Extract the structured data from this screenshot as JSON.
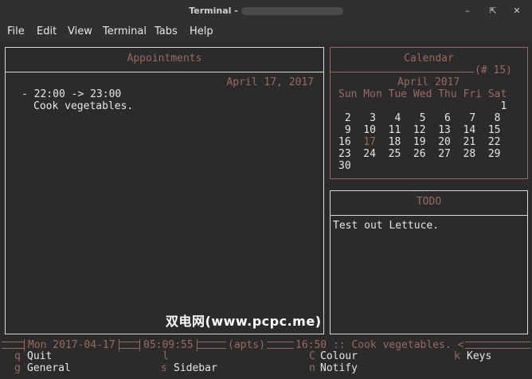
{
  "window": {
    "title": "Terminal -"
  },
  "menu": [
    "File",
    "Edit",
    "View",
    "Terminal",
    "Tabs",
    "Help"
  ],
  "appointments": {
    "header": "Appointments",
    "date": "April 17, 2017",
    "entry_time": "- 22:00 -> 23:00",
    "entry_text": "Cook vegetables."
  },
  "calendar": {
    "header": "Calendar",
    "week_label": "(# 15)",
    "month": "April 2017",
    "weekdays": "Sun Mon Tue Wed Thu Fri Sat",
    "weeks": [
      "                          1",
      " 2   3   4   5   6   7   8",
      " 9  10  11  12  13  14  15",
      "16  17  18  19  20  21  22",
      "23  24  25  26  27  28  29",
      "30"
    ],
    "selected_day": "17"
  },
  "todo": {
    "header": "TODO",
    "item": "Test out Lettuce."
  },
  "status": {
    "day_date": "Mon 2017-04-17",
    "time": "05:09:55",
    "mode": "(apts)",
    "next_appt": "16:50 :: Cook vegetables. <"
  },
  "keys": [
    {
      "key": "q",
      "label": "Quit"
    },
    {
      "key": "l",
      "label": ""
    },
    {
      "key": "C",
      "label": "Colour"
    },
    {
      "key": "k",
      "label": "Keys"
    },
    {
      "key": "g",
      "label": "General"
    },
    {
      "key": "s",
      "label": "Sidebar"
    },
    {
      "key": "n",
      "label": "Notify"
    }
  ],
  "watermark": "双电网(www.pcpc.me)"
}
